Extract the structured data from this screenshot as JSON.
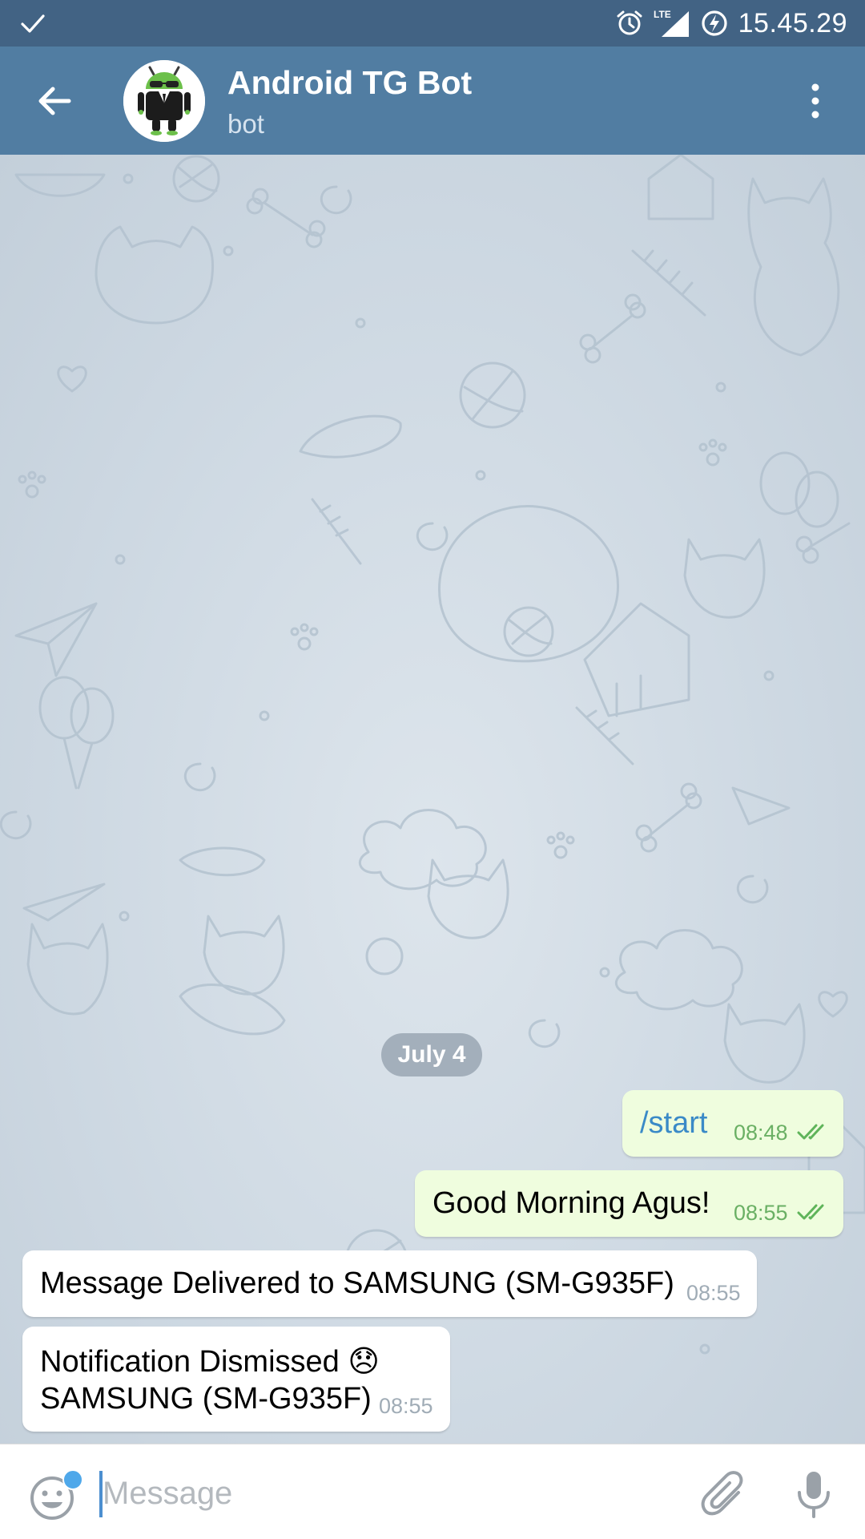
{
  "status_bar": {
    "network": "LTE",
    "time": "15.45.29",
    "icons": [
      "check-icon",
      "alarm-icon",
      "signal-icon",
      "battery-charging-icon"
    ]
  },
  "header": {
    "title": "Android TG Bot",
    "subtitle": "bot",
    "icons": [
      "back-arrow-icon",
      "bot-avatar",
      "more-vertical-icon"
    ],
    "color": "#517da2"
  },
  "chat": {
    "date_label": "July 4",
    "messages": [
      {
        "direction": "out",
        "text": "/start",
        "time": "08:48",
        "status": "read",
        "is_command": true
      },
      {
        "direction": "out",
        "text": "Good Morning Agus!",
        "time": "08:55",
        "status": "read"
      },
      {
        "direction": "in",
        "text": "Message Delivered to SAMSUNG (SM-G935F)",
        "time": "08:55"
      },
      {
        "direction": "in",
        "line1": "Notification Dismissed",
        "emoji": "😞",
        "line2": "SAMSUNG (SM-G935F)",
        "time": "08:55"
      }
    ],
    "outgoing_bubble_color": "#effdde",
    "command_color": "#3a8ac7"
  },
  "input_bar": {
    "placeholder": "Message",
    "icons": [
      "emoji-icon",
      "attach-paperclip-icon",
      "microphone-icon"
    ],
    "notification_dot_color": "#4fa8ea"
  }
}
